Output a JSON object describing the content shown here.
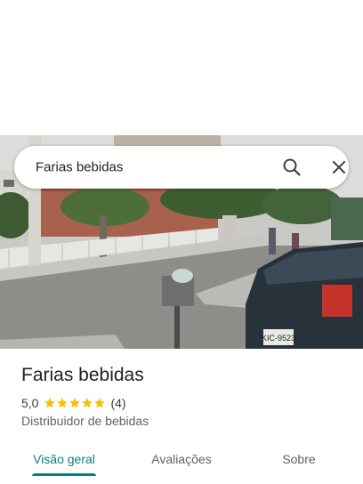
{
  "search": {
    "query": "Farias bebidas",
    "search_icon": "search-icon",
    "close_icon": "close-icon"
  },
  "photo": {
    "subject": "street-view-photo",
    "car_plate": "KIC-9523"
  },
  "place": {
    "name": "Farias bebidas",
    "rating": "5,0",
    "stars": 5,
    "review_count": "(4)",
    "category": "Distribuidor de bebidas"
  },
  "tabs": [
    {
      "label": "Visão geral",
      "active": true
    },
    {
      "label": "Avaliações",
      "active": false
    },
    {
      "label": "Sobre",
      "active": false
    }
  ],
  "colors": {
    "accent": "#0b7c84",
    "star": "#fbbc04"
  }
}
